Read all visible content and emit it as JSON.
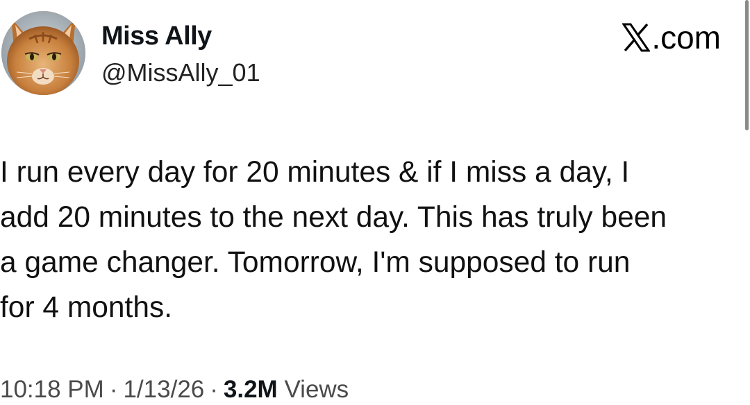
{
  "author": {
    "display_name": "Miss Ally",
    "handle": "@MissAlly_01",
    "avatar_icon": "cat-avatar-icon"
  },
  "brand": {
    "icon": "x-logo-icon",
    "text": ".com"
  },
  "tweet": {
    "lines": [
      "I run every day for 20 minutes & if I miss a day, I",
      "add 20 minutes to the next day. This has truly been",
      "a game changer. Tomorrow, I'm supposed to run",
      "for 4 months."
    ]
  },
  "meta": {
    "time": "10:18 PM",
    "separator": "·",
    "date": "1/13/26",
    "views_count": "3.2M",
    "views_label": "Views"
  },
  "colors": {
    "text": "#111111",
    "secondary": "#4a4a4a",
    "background": "#ffffff"
  }
}
